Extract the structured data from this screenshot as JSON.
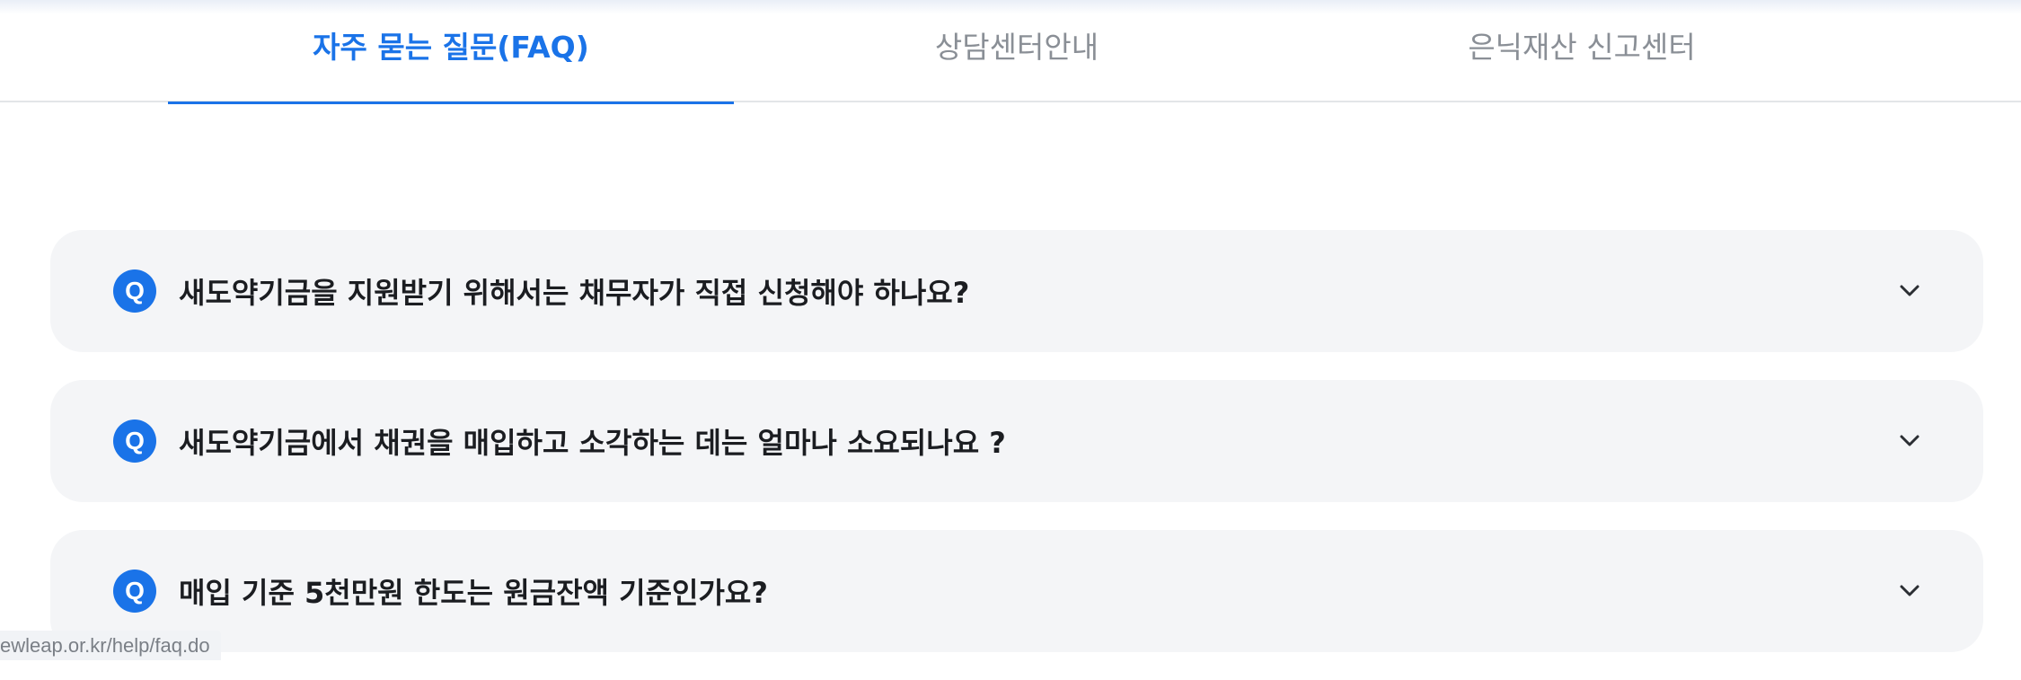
{
  "tabs": [
    {
      "label": "자주 묻는 질문(FAQ)",
      "active": true
    },
    {
      "label": "상담센터안내",
      "active": false
    },
    {
      "label": "은닉재산 신고센터",
      "active": false
    }
  ],
  "faq": {
    "badge": "Q",
    "items": [
      {
        "question": "새도약기금을 지원받기 위해서는 채무자가 직접 신청해야 하나요?"
      },
      {
        "question": "새도약기금에서 채권을 매입하고 소각하는 데는 얼마나 소요되나요 ?"
      },
      {
        "question": "매입 기준 5천만원 한도는 원금잔액 기준인가요?"
      }
    ]
  },
  "status_bar": {
    "url": "ewleap.or.kr/help/faq.do"
  },
  "colors": {
    "accent": "#1a73e8",
    "card_bg": "#f4f5f7",
    "inactive_tab": "#8a8f96"
  },
  "icons": {
    "expand": "chevron-down-icon"
  }
}
